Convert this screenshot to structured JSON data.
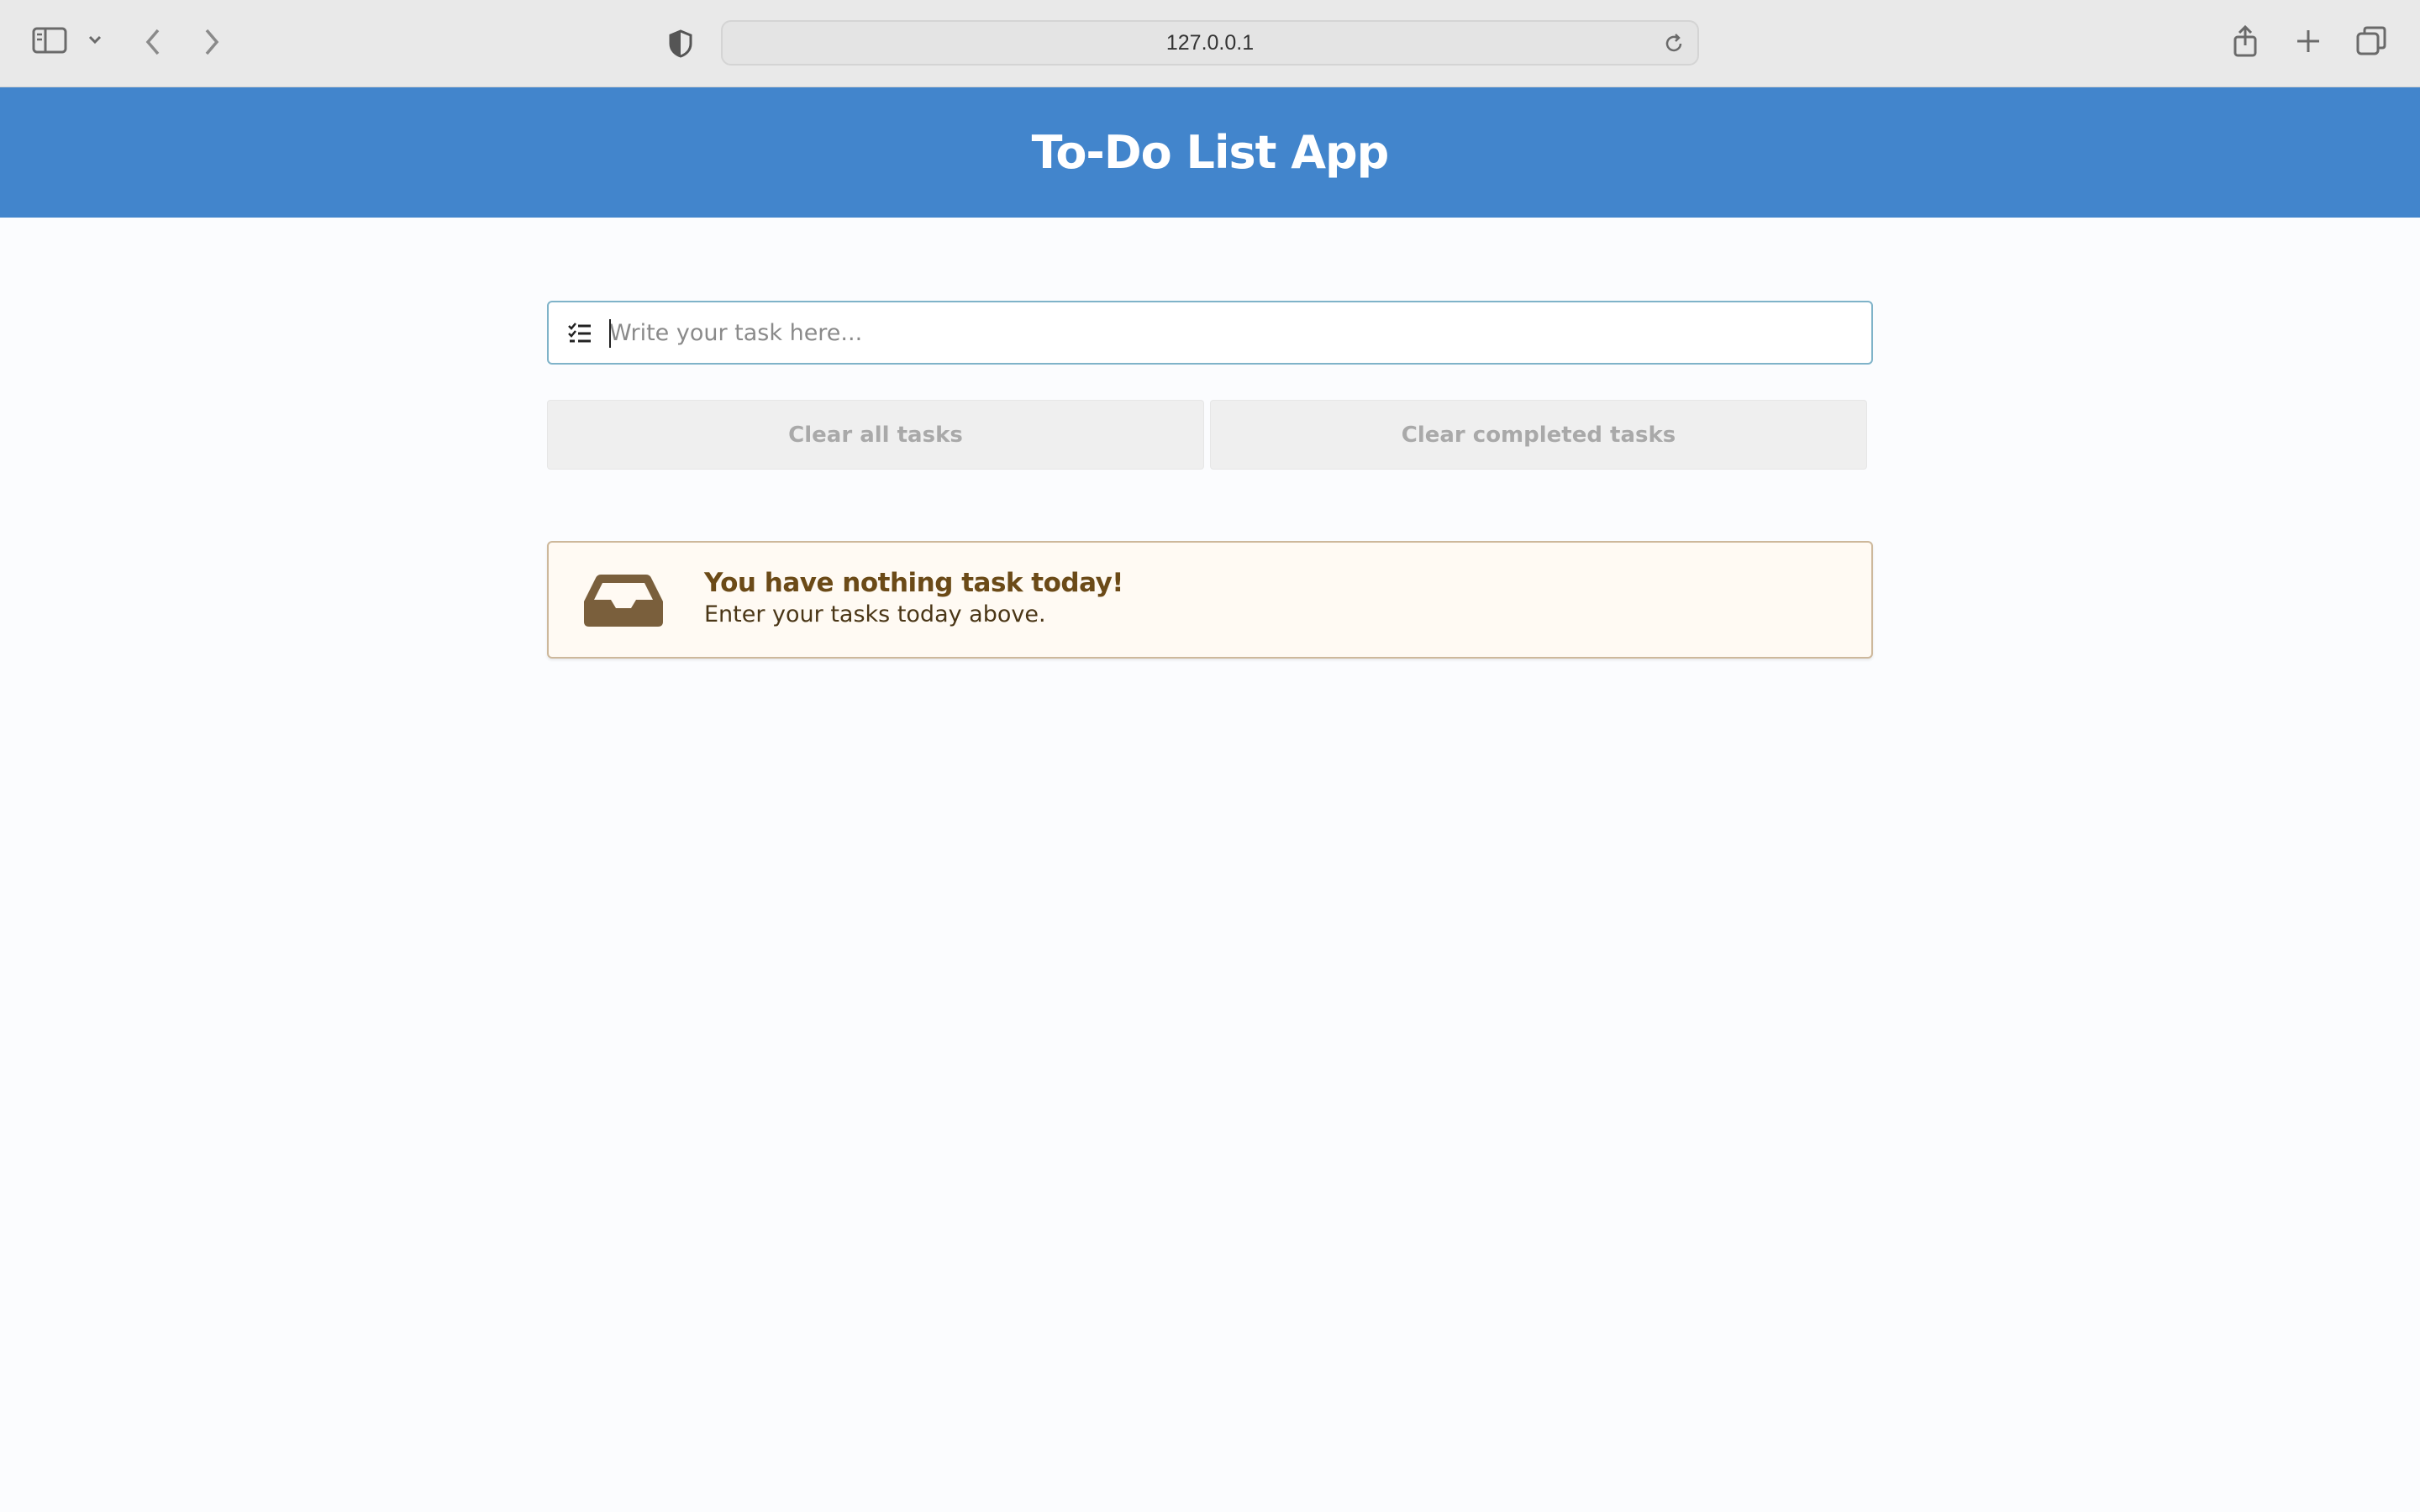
{
  "browser": {
    "url": "127.0.0.1",
    "icons": {
      "sidebar": "sidebar-icon",
      "dropdown": "chevron-down-icon",
      "back": "back-icon",
      "forward": "forward-icon",
      "privacy": "shield-icon",
      "reload": "reload-icon",
      "share": "share-icon",
      "new_tab": "plus-icon",
      "tabs": "tabs-overview-icon"
    }
  },
  "header": {
    "title": "To-Do List App",
    "background_color": "#4285cc"
  },
  "task_input": {
    "placeholder": "Write your task here...",
    "value": "",
    "icon": "task-list-icon"
  },
  "actions": {
    "clear_all_label": "Clear all tasks",
    "clear_completed_label": "Clear completed tasks"
  },
  "empty_state": {
    "icon": "inbox-icon",
    "title": "You have nothing task today!",
    "subtitle": "Enter your tasks today above.",
    "accent_color": "#6b4a17"
  }
}
